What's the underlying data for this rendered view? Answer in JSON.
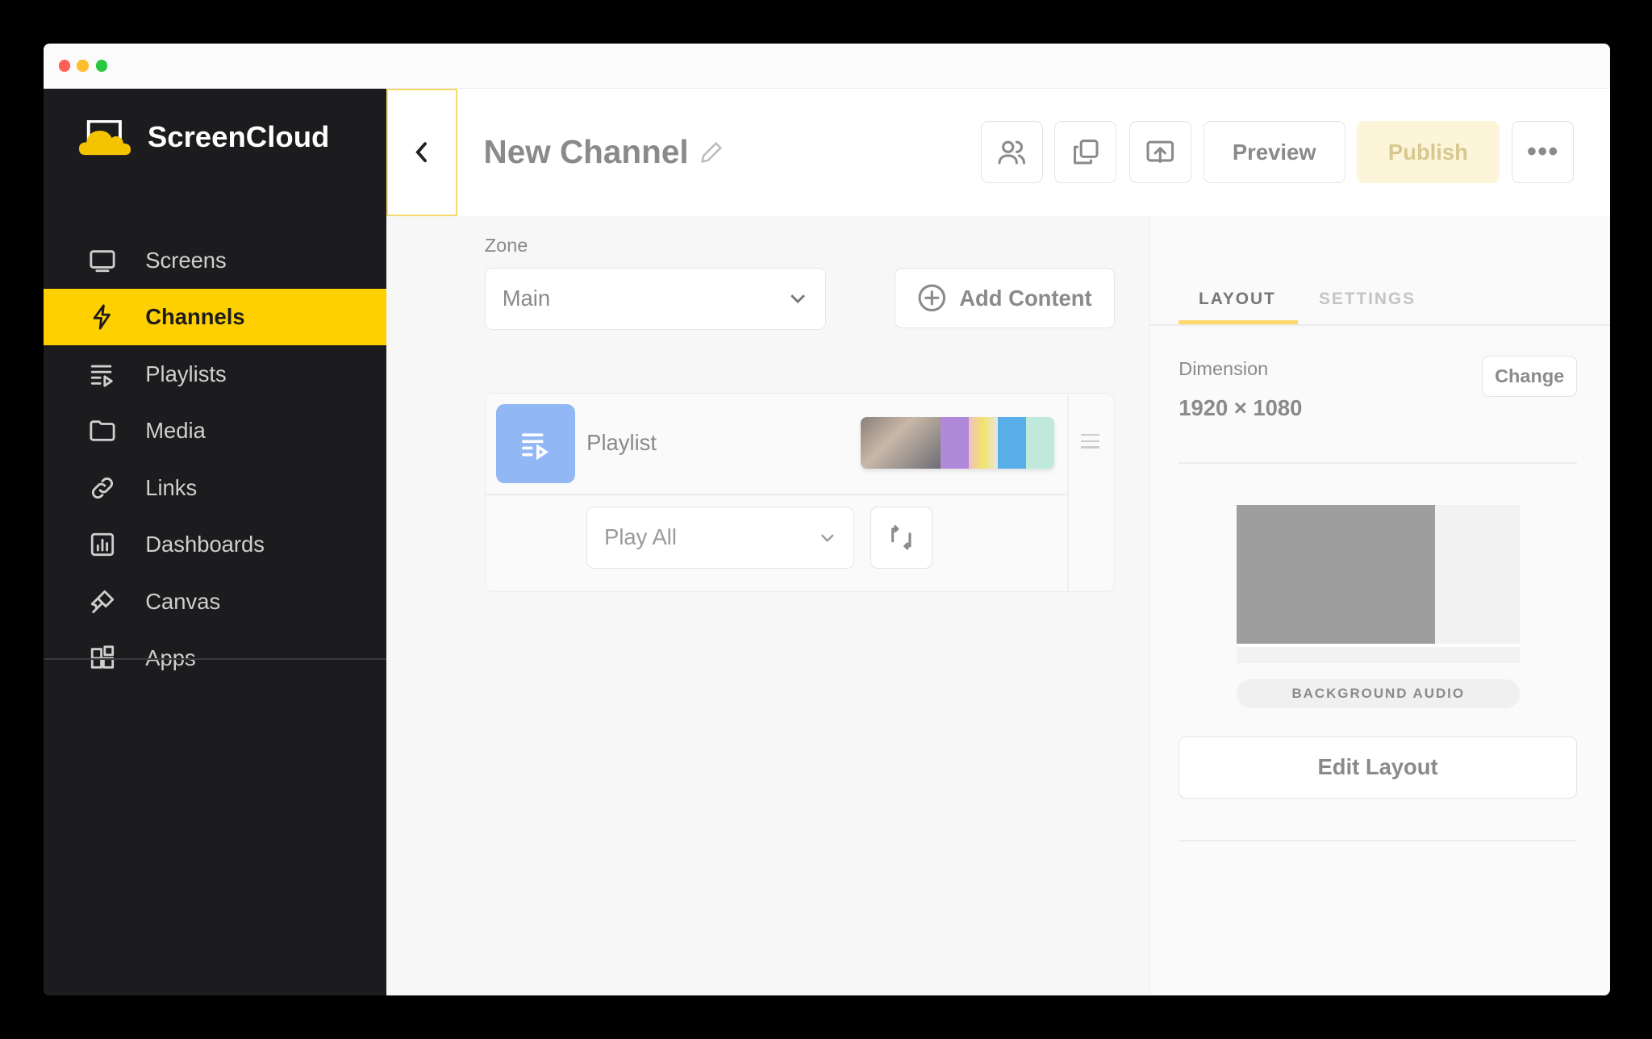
{
  "brand": {
    "name": "ScreenCloud"
  },
  "window": {
    "controls": [
      "close",
      "minimize",
      "maximize"
    ]
  },
  "sidebar": {
    "items": [
      {
        "label": "Screens",
        "icon": "monitor-icon"
      },
      {
        "label": "Channels",
        "icon": "lightning-icon",
        "active": true
      },
      {
        "label": "Playlists",
        "icon": "playlist-icon"
      },
      {
        "label": "Media",
        "icon": "folder-icon"
      },
      {
        "label": "Links",
        "icon": "link-icon"
      },
      {
        "label": "Dashboards",
        "icon": "chart-icon"
      },
      {
        "label": "Canvas",
        "icon": "brush-icon"
      },
      {
        "label": "Apps",
        "icon": "apps-icon"
      }
    ]
  },
  "header": {
    "title": "New Channel",
    "preview_label": "Preview",
    "publish_label": "Publish"
  },
  "zone": {
    "label": "Zone",
    "value": "Main",
    "add_content_label": "Add Content"
  },
  "playlist_item": {
    "name": "Playlist",
    "play_mode": "Play All"
  },
  "right_panel": {
    "tabs": [
      {
        "label": "LAYOUT",
        "active": true
      },
      {
        "label": "SETTINGS"
      }
    ],
    "dimension_label": "Dimension",
    "dimension_value": "1920 × 1080",
    "change_label": "Change",
    "background_audio_label": "BACKGROUND AUDIO",
    "edit_layout_label": "Edit Layout"
  },
  "colors": {
    "accent": "#ffd000",
    "sidebar": "#1c1c1e",
    "playlist_icon_bg": "#91b7f5"
  }
}
